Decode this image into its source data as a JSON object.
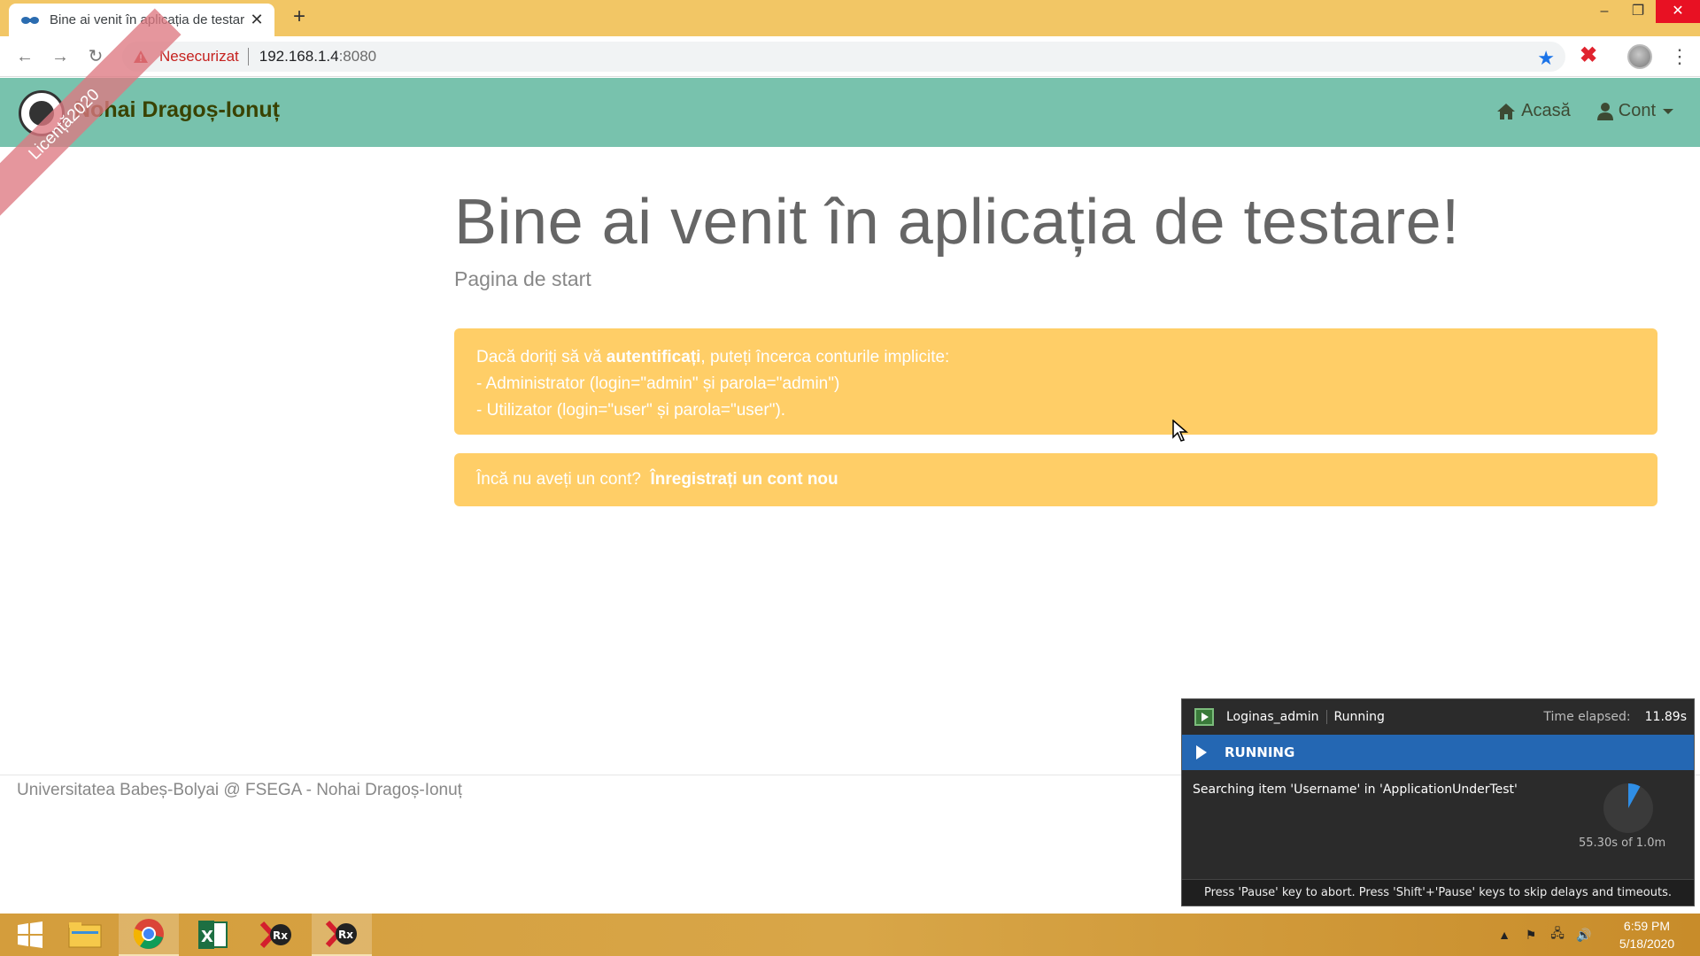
{
  "browser": {
    "tab_title": "Bine ai venit în aplicația de testar",
    "not_secure_label": "Nesecurizat",
    "url_host": "192.168.1.4",
    "url_port": ":8080",
    "new_tab_symbol": "+",
    "close_symbol": "✕"
  },
  "navbar": {
    "brand": "Nohai Dragoș-Ionuț",
    "home_label": "Acasă",
    "account_label": "Cont"
  },
  "ribbon": {
    "text": "Licență2020"
  },
  "main": {
    "title": "Bine ai venit în aplicația de testare!",
    "subtitle": "Pagina de start",
    "login_alert": {
      "line1_prefix": "Dacă doriți să vă ",
      "line1_bold": "autentificați",
      "line1_suffix": ", puteți încerca conturile implicite:",
      "line2": "- Administrator (login=\"admin\" și parola=\"admin\")",
      "line3": "- Utilizator (login=\"user\" și parola=\"user\")."
    },
    "register_alert": {
      "prefix": "Încă nu aveți un cont?",
      "link": "Înregistrați un cont nou"
    }
  },
  "footer": {
    "text": "Universitatea Babeș-Bolyai @ FSEGA - Nohai Dragoș-Ionuț"
  },
  "ranorex_panel": {
    "test_name": "Loginas_admin",
    "status": "Running",
    "time_elapsed_label": "Time elapsed:",
    "time_elapsed": "11.89s",
    "state_banner": "RUNNING",
    "message": "Searching item 'Username' in 'ApplicationUnderTest'",
    "progress_text": "55.30s of 1.0m",
    "progress_fraction": 0.08,
    "footer_hint": "Press 'Pause' key to abort. Press 'Shift'+'Pause' keys to skip delays and timeouts."
  },
  "taskbar": {
    "items": [
      "start-menu",
      "file-explorer",
      "google-chrome",
      "microsoft-excel",
      "ranorex-studio",
      "ranorex-studio-active"
    ],
    "time": "6:59 PM",
    "date": "5/18/2020"
  },
  "colors": {
    "tabstrip": "#f2c665",
    "navbar": "#78c2ad",
    "alert": "#ffce67",
    "ribbon": "#de7882",
    "ranorex_bar": "#2467b3"
  }
}
